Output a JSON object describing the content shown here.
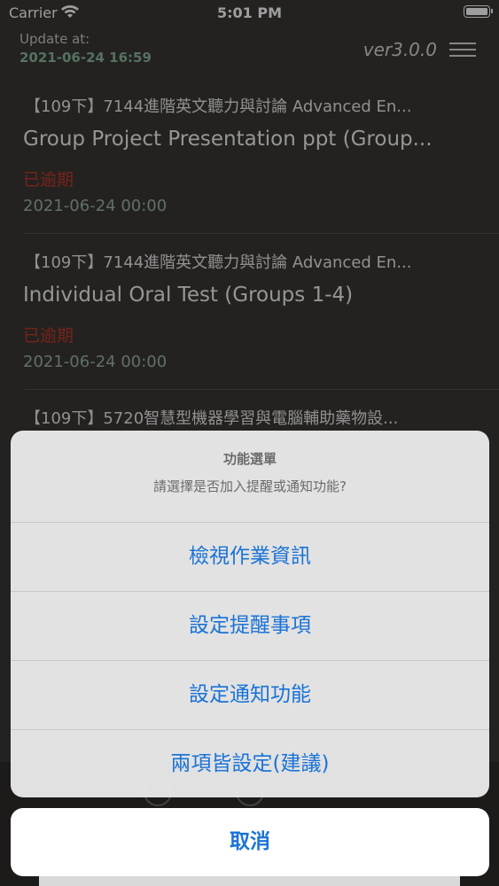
{
  "status_bar": {
    "carrier": "Carrier",
    "time": "5:01 PM"
  },
  "header": {
    "update_label": "Update at:",
    "update_time": "2021-06-24 16:59",
    "version": "ver3.0.0",
    "accent_color": "#8ab89c"
  },
  "assignments": [
    {
      "course": "【109下】7144進階英文聽力與討論 Advanced En...",
      "title": "Group Project Presentation ppt (Group...",
      "status": "已逾期",
      "date": "2021-06-24 00:00"
    },
    {
      "course": "【109下】7144進階英文聽力與討論 Advanced En...",
      "title": "Individual Oral Test (Groups 1-4)",
      "status": "已逾期",
      "date": "2021-06-24 00:00"
    },
    {
      "course": "【109下】5720智慧型機器學習與電腦輔助藥物設...",
      "title": "",
      "status": "",
      "date": ""
    }
  ],
  "action_sheet": {
    "title": "功能選單",
    "message": "請選擇是否加入提醒或通知功能?",
    "buttons": [
      "檢視作業資訊",
      "設定提醒事項",
      "設定通知功能",
      "兩項皆設定(建議)"
    ],
    "cancel": "取消",
    "button_color": "#1a73d6"
  },
  "colors": {
    "background": "#3a3734",
    "overdue": "#c0392b",
    "date": "#9bb5a8"
  }
}
